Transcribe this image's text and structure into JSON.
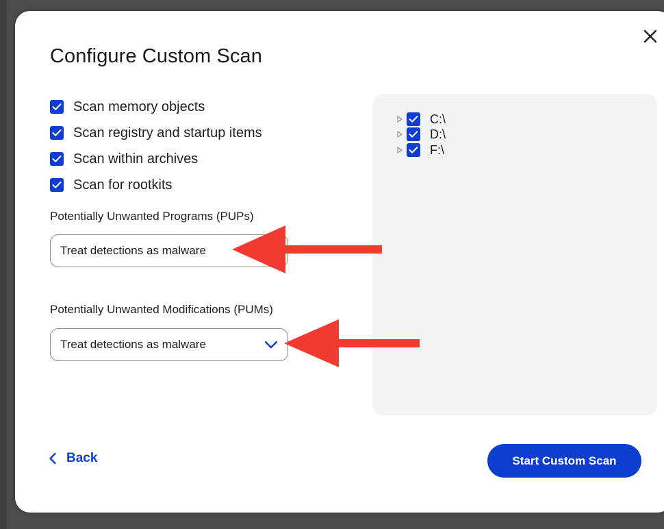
{
  "dialog": {
    "title": "Configure Custom Scan"
  },
  "scan_options": [
    {
      "label": "Scan memory objects",
      "checked": true
    },
    {
      "label": "Scan registry and startup items",
      "checked": true
    },
    {
      "label": "Scan within archives",
      "checked": true
    },
    {
      "label": "Scan for rootkits",
      "checked": true
    }
  ],
  "pups": {
    "label": "Potentially Unwanted Programs (PUPs)",
    "value": "Treat detections as malware"
  },
  "pums": {
    "label": "Potentially Unwanted Modifications (PUMs)",
    "value": "Treat detections as malware"
  },
  "drives": [
    {
      "label": "C:\\",
      "checked": true
    },
    {
      "label": "D:\\",
      "checked": true
    },
    {
      "label": "F:\\",
      "checked": true
    }
  ],
  "footer": {
    "back_label": "Back",
    "start_label": "Start Custom Scan"
  },
  "colors": {
    "accent": "#0d3ecf",
    "annotation_arrow": "#f03b32",
    "panel_bg": "#f2f4f3"
  },
  "icons": {
    "close": "close-icon",
    "checkbox": "checkmark-icon",
    "dropdown": "chevron-down-icon",
    "back": "chevron-left-icon",
    "tree": "triangle-right-icon"
  }
}
